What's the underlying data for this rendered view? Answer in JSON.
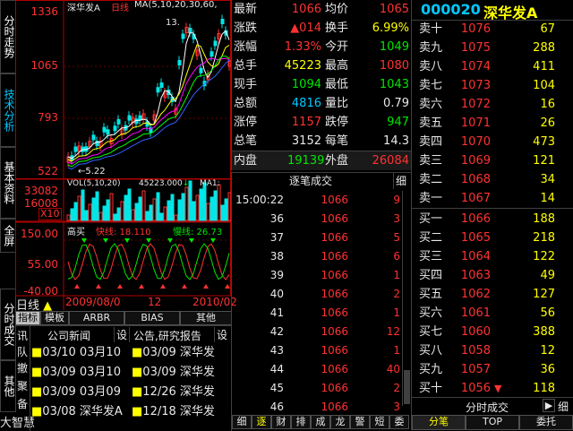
{
  "left_tabs": [
    "分时走势",
    "技术分析",
    "基本资料",
    "全屏",
    "分时成交",
    "其他",
    "大智慧"
  ],
  "kline": {
    "stock_name": "深华发A",
    "period": "日线",
    "ma_label": "MA(5,10,20,30,60,",
    "axis": [
      "1336",
      "1065",
      "793",
      "522"
    ],
    "low_mark": "5.22",
    "high_mark": "13.",
    "vol_label": "VOL(5,10,20)",
    "vol_value": "45223.000",
    "vol_ma": "MA1:",
    "vol_axis": [
      "33082",
      "16008",
      "X10"
    ],
    "ind_label": "高买",
    "ind_fast": "快线: 18.110",
    "ind_slow": "慢线: 26.73",
    "ind_axis": [
      "150.00",
      "55.00",
      "-40.00"
    ],
    "date_left": "2009/08/0",
    "date_mid": "12",
    "date_right": "2010/02",
    "period_btn": "日线",
    "ind_tabs": [
      "指标",
      "模板",
      "ARBR",
      "BIAS",
      "其他"
    ]
  },
  "news": {
    "tab_vertical": [
      "讯",
      "队",
      "撤",
      "聚",
      "备"
    ],
    "col1_title": "公司新闻",
    "col1_btn": "设",
    "col2_title": "公告,研究报告",
    "col2_btn": "设",
    "col1": [
      "03/10 03月10",
      "03/09 03月10",
      "03/09 03月09",
      "03/08 深华发A"
    ],
    "col2": [
      "03/09 深华发",
      "03/09 深华发",
      "12/26 深华发",
      "12/18 深华发"
    ]
  },
  "quote": {
    "rows": [
      {
        "l1": "最新",
        "v1": "1066",
        "l2": "均价",
        "v2": "1065",
        "c1": "red",
        "c2": "red"
      },
      {
        "l1": "涨跌",
        "v1": "▲014",
        "l2": "换手",
        "v2": "6.99%",
        "c1": "red",
        "c2": "yellow"
      },
      {
        "l1": "涨幅",
        "v1": "1.33%",
        "l2": "今开",
        "v2": "1049",
        "c1": "red",
        "c2": "green"
      },
      {
        "l1": "总手",
        "v1": "45223",
        "l2": "最高",
        "v2": "1080",
        "c1": "yellow",
        "c2": "red"
      },
      {
        "l1": "现手",
        "v1": "1094",
        "l2": "最低",
        "v2": "1043",
        "c1": "green",
        "c2": "green"
      },
      {
        "l1": "总额",
        "v1": "4816",
        "l2": "量比",
        "v2": "0.79",
        "c1": "cyan",
        "c2": "white"
      },
      {
        "l1": "涨停",
        "v1": "1157",
        "l2": "跌停",
        "v2": "947",
        "c1": "red",
        "c2": "green"
      },
      {
        "l1": "总笔",
        "v1": "3152",
        "l2": "每笔",
        "v2": "14.3",
        "c1": "white",
        "c2": "white"
      }
    ],
    "inner_label": "内盘",
    "inner_value": "19139",
    "outer_label": "外盘",
    "outer_value": "26084"
  },
  "ticks": {
    "title": "逐笔成交",
    "detail_btn": "细",
    "rows": [
      {
        "t": "15:00:22",
        "p": "1066",
        "v": "9"
      },
      {
        "t": "36",
        "p": "1066",
        "v": "3"
      },
      {
        "t": "37",
        "p": "1066",
        "v": "5"
      },
      {
        "t": "38",
        "p": "1066",
        "v": "6"
      },
      {
        "t": "39",
        "p": "1066",
        "v": "1"
      },
      {
        "t": "40",
        "p": "1066",
        "v": "2"
      },
      {
        "t": "41",
        "p": "1066",
        "v": "1"
      },
      {
        "t": "42",
        "p": "1066",
        "v": "12"
      },
      {
        "t": "43",
        "p": "1066",
        "v": "1"
      },
      {
        "t": "44",
        "p": "1066",
        "v": "40"
      },
      {
        "t": "45",
        "p": "1066",
        "v": "2"
      },
      {
        "t": "46",
        "p": "1066",
        "v": "3"
      }
    ],
    "bottom_tabs": [
      "细",
      "逐",
      "财",
      "排",
      "成",
      "龙",
      "警",
      "短",
      "委"
    ]
  },
  "book": {
    "code": "000020",
    "name": "深华发A",
    "asks": [
      {
        "l": "卖十",
        "p": "1076",
        "v": "67"
      },
      {
        "l": "卖九",
        "p": "1075",
        "v": "288"
      },
      {
        "l": "卖八",
        "p": "1074",
        "v": "411"
      },
      {
        "l": "卖七",
        "p": "1073",
        "v": "104"
      },
      {
        "l": "卖六",
        "p": "1072",
        "v": "16"
      },
      {
        "l": "卖五",
        "p": "1071",
        "v": "26"
      },
      {
        "l": "卖四",
        "p": "1070",
        "v": "473"
      },
      {
        "l": "卖三",
        "p": "1069",
        "v": "121"
      },
      {
        "l": "卖二",
        "p": "1068",
        "v": "34"
      },
      {
        "l": "卖一",
        "p": "1067",
        "v": "14"
      }
    ],
    "bids": [
      {
        "l": "买一",
        "p": "1066",
        "v": "188"
      },
      {
        "l": "买二",
        "p": "1065",
        "v": "218"
      },
      {
        "l": "买三",
        "p": "1064",
        "v": "122"
      },
      {
        "l": "买四",
        "p": "1063",
        "v": "49"
      },
      {
        "l": "买五",
        "p": "1062",
        "v": "127"
      },
      {
        "l": "买六",
        "p": "1061",
        "v": "56"
      },
      {
        "l": "买七",
        "p": "1060",
        "v": "388"
      },
      {
        "l": "买八",
        "p": "1058",
        "v": "12"
      },
      {
        "l": "买九",
        "p": "1057",
        "v": "36"
      },
      {
        "l": "买十",
        "p": "1056",
        "v": "118"
      }
    ],
    "footer_title": "分时成交",
    "bottom_tabs": [
      "分笔",
      "TOP",
      "委托"
    ]
  },
  "colors": {
    "up": "#ff3232",
    "down": "#00e600",
    "accent": "#ffff00",
    "border": "#404040"
  }
}
